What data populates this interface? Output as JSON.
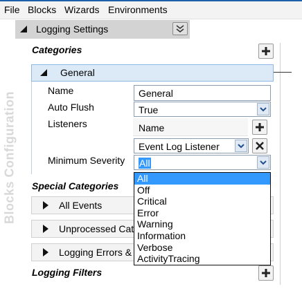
{
  "menu": [
    "File",
    "Blocks",
    "Wizards",
    "Environments"
  ],
  "sidebar_label": "Blocks Configuration",
  "section": {
    "title": "Logging Settings"
  },
  "categories": {
    "heading": "Categories",
    "general": {
      "label": "General",
      "props": {
        "name_label": "Name",
        "name_value": "General",
        "autoflush_label": "Auto Flush",
        "autoflush_value": "True",
        "listeners_label": "Listeners",
        "listeners_header": "Name",
        "listener_value": "Event Log Listener",
        "min_severity_label": "Minimum Severity",
        "min_severity_value": "All"
      }
    }
  },
  "special_categories": {
    "heading": "Special Categories",
    "items": [
      "All Events",
      "Unprocessed Cate",
      "Logging Errors &"
    ]
  },
  "logging_filters": {
    "heading": "Logging Filters"
  },
  "severity_dropdown": {
    "options": [
      "All",
      "Off",
      "Critical",
      "Error",
      "Warning",
      "Information",
      "Verbose",
      "ActivityTracing"
    ],
    "selected_index": 0
  },
  "colors": {
    "selection": "#3399ff",
    "menu_accent": "#1e5fa9",
    "category_header": "#dceaf8"
  }
}
